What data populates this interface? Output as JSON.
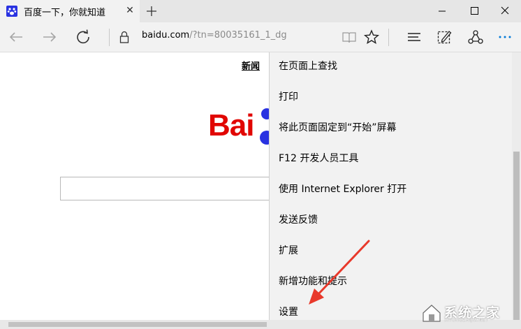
{
  "tab": {
    "title": "百度一下，你就知道",
    "close_glyph": "✕",
    "favicon": "baidu-paw-icon"
  },
  "address": {
    "host": "baidu.com",
    "path": "/?tn=80035161_1_dg"
  },
  "page": {
    "news_link": "新闻",
    "logo_text": "Bai"
  },
  "menu": {
    "items": [
      "在页面上查找",
      "打印",
      "将此页面固定到“开始”屏幕",
      "F12 开发人员工具",
      "使用 Internet Explorer 打开",
      "发送反馈",
      "扩展",
      "新增功能和提示",
      "设置"
    ]
  },
  "watermark": {
    "text": "系统之家",
    "sub": "XITONGZHIJIA.NET"
  },
  "colors": {
    "accent": "#0078d7",
    "baidu_red": "#e10602",
    "baidu_blue": "#2932e1",
    "arrow": "#e8392b"
  }
}
